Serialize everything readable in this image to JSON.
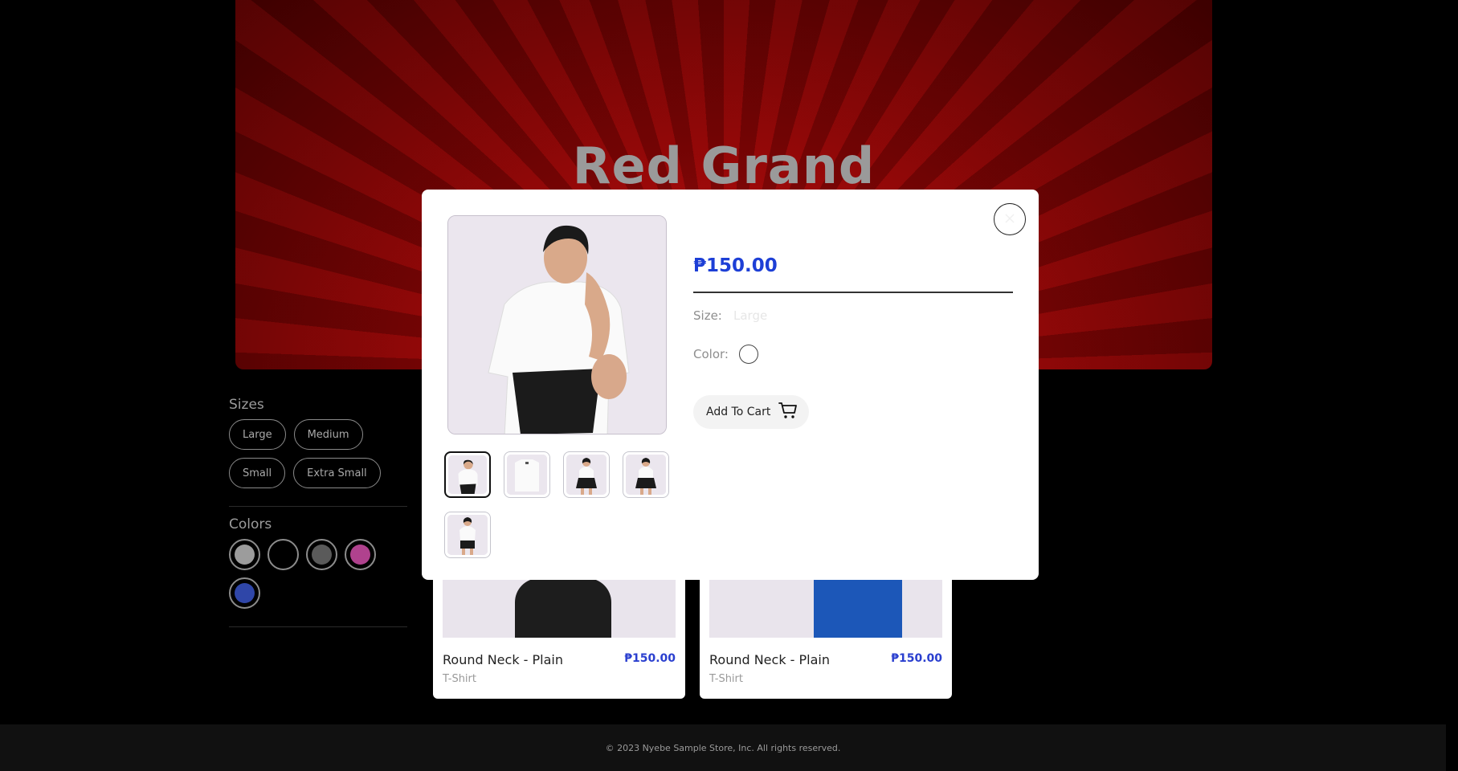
{
  "hero": {
    "title": "Red Grand"
  },
  "sidebar": {
    "sizes_heading": "Sizes",
    "sizes": [
      "Large",
      "Medium",
      "Small",
      "Extra Small"
    ],
    "colors_heading": "Colors",
    "colors": [
      "#9c9c9c",
      "#000000",
      "#5a5a5a",
      "#b0428e",
      "#2f46a8"
    ]
  },
  "products": [
    {
      "title": "Round Neck - Plain",
      "category": "T-Shirt",
      "price": "₱150.00"
    },
    {
      "title": "Round Neck - Plain",
      "category": "T-Shirt",
      "price": "₱150.00"
    }
  ],
  "modal": {
    "price": "₱150.00",
    "size_label": "Size:",
    "size_value": "Large",
    "color_label": "Color:",
    "selected_color": "#ffffff",
    "add_to_cart_label": "Add To Cart",
    "thumbnail_count": 5
  },
  "footer": {
    "copyright": "© 2023 Nyebe Sample Store, Inc. All rights reserved."
  },
  "theme": {
    "accent": "#1d3fd6",
    "hero_red": "#8a0505"
  }
}
